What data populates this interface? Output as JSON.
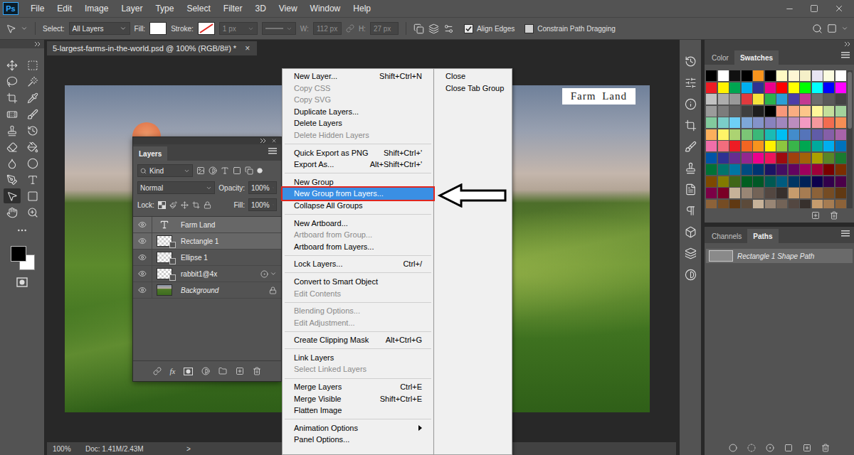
{
  "app": {
    "logo": "Ps"
  },
  "menubar": {
    "items": [
      "File",
      "Edit",
      "Image",
      "Layer",
      "Type",
      "Select",
      "Filter",
      "3D",
      "View",
      "Window",
      "Help"
    ]
  },
  "options_bar": {
    "select_label": "Select:",
    "select_value": "All Layers",
    "fill_label": "Fill:",
    "stroke_label": "Stroke:",
    "stroke_width": "1 px",
    "stroke_width_disabled": true,
    "size_fields": [
      {
        "label": "W:",
        "value": "112 px",
        "disabled": true
      },
      {
        "label": "H:",
        "value": "27 px",
        "disabled": true
      }
    ],
    "checkboxes": [
      {
        "label": "Align Edges",
        "checked": true
      },
      {
        "label": "Constrain Path Dragging",
        "checked": false
      }
    ]
  },
  "toolbar": {
    "tools": [
      {
        "selected": false
      },
      {
        "selected": false
      },
      {
        "selected": false
      },
      {
        "selected": false
      },
      {
        "selected": false
      },
      {
        "selected": false
      },
      {
        "selected": false
      },
      {
        "selected": false
      },
      {
        "selected": false
      },
      {
        "selected": false
      },
      {
        "selected": false
      },
      {
        "selected": false
      },
      {
        "selected": false
      },
      {
        "selected": false
      },
      {
        "selected": false
      },
      {
        "selected": false
      },
      {
        "selected": true
      },
      {
        "selected": false
      },
      {
        "selected": false
      },
      {
        "selected": false
      }
    ]
  },
  "document": {
    "tab": "5-largest-farms-in-the-world.psd @ 100% (RGB/8#) *",
    "close": "×",
    "canvas_text": "Farm Land",
    "zoom": "100%",
    "doc_info": "Doc: 1.41M/2.43M",
    "status_arrow": ">"
  },
  "layers_panel": {
    "title": "Layers",
    "filter": "Kind",
    "blend_mode": "Normal",
    "opacity_label": "Opacity:",
    "opacity": "100%",
    "lock_label": "Lock:",
    "fill_label": "Fill:",
    "fill": "100%",
    "fx": "fx",
    "layers": [
      {
        "name": "Farm Land",
        "kind": "text",
        "visible": true,
        "selected": true
      },
      {
        "name": "Rectangle 1",
        "kind": "shape",
        "visible": true,
        "selected": true
      },
      {
        "name": "Ellipse 1",
        "kind": "shape",
        "visible": true,
        "selected": false
      },
      {
        "name": "rabbit1@4x",
        "kind": "smart",
        "visible": true,
        "selected": false
      },
      {
        "name": "Background",
        "kind": "background",
        "visible": true,
        "selected": false
      }
    ]
  },
  "context_menu": {
    "items": [
      {
        "label": "New Layer...",
        "shortcut": "Shift+Ctrl+N",
        "disabled": false,
        "selected": false,
        "submenu": false,
        "separator_after": false
      },
      {
        "label": "Copy CSS",
        "shortcut": "",
        "disabled": true,
        "selected": false,
        "submenu": false,
        "separator_after": false
      },
      {
        "label": "Copy SVG",
        "shortcut": "",
        "disabled": true,
        "selected": false,
        "submenu": false,
        "separator_after": false
      },
      {
        "label": "Duplicate Layers...",
        "shortcut": "",
        "disabled": false,
        "selected": false,
        "submenu": false,
        "separator_after": false
      },
      {
        "label": "Delete Layers",
        "shortcut": "",
        "disabled": false,
        "selected": false,
        "submenu": false,
        "separator_after": false
      },
      {
        "label": "Delete Hidden Layers",
        "shortcut": "",
        "disabled": true,
        "selected": false,
        "submenu": false,
        "separator_after": true
      },
      {
        "label": "Quick Export as PNG",
        "shortcut": "Shift+Ctrl+'",
        "disabled": false,
        "selected": false,
        "submenu": false,
        "separator_after": false
      },
      {
        "label": "Export As...",
        "shortcut": "Alt+Shift+Ctrl+'",
        "disabled": false,
        "selected": false,
        "submenu": false,
        "separator_after": true
      },
      {
        "label": "New Group",
        "shortcut": "",
        "disabled": false,
        "selected": false,
        "submenu": false,
        "separator_after": false
      },
      {
        "label": "New Group from Layers...",
        "shortcut": "",
        "disabled": false,
        "selected": true,
        "submenu": false,
        "separator_after": false
      },
      {
        "label": "Collapse All Groups",
        "shortcut": "",
        "disabled": false,
        "selected": false,
        "submenu": false,
        "separator_after": true
      },
      {
        "label": "New Artboard...",
        "shortcut": "",
        "disabled": false,
        "selected": false,
        "submenu": false,
        "separator_after": false
      },
      {
        "label": "Artboard from Group...",
        "shortcut": "",
        "disabled": true,
        "selected": false,
        "submenu": false,
        "separator_after": false
      },
      {
        "label": "Artboard from Layers...",
        "shortcut": "",
        "disabled": false,
        "selected": false,
        "submenu": false,
        "separator_after": true
      },
      {
        "label": "Lock Layers...",
        "shortcut": "Ctrl+/",
        "disabled": false,
        "selected": false,
        "submenu": false,
        "separator_after": true
      },
      {
        "label": "Convert to Smart Object",
        "shortcut": "",
        "disabled": false,
        "selected": false,
        "submenu": false,
        "separator_after": false
      },
      {
        "label": "Edit Contents",
        "shortcut": "",
        "disabled": true,
        "selected": false,
        "submenu": false,
        "separator_after": true
      },
      {
        "label": "Blending Options...",
        "shortcut": "",
        "disabled": true,
        "selected": false,
        "submenu": false,
        "separator_after": false
      },
      {
        "label": "Edit Adjustment...",
        "shortcut": "",
        "disabled": true,
        "selected": false,
        "submenu": false,
        "separator_after": true
      },
      {
        "label": "Create Clipping Mask",
        "shortcut": "Alt+Ctrl+G",
        "disabled": false,
        "selected": false,
        "submenu": false,
        "separator_after": true
      },
      {
        "label": "Link Layers",
        "shortcut": "",
        "disabled": false,
        "selected": false,
        "submenu": false,
        "separator_after": false
      },
      {
        "label": "Select Linked Layers",
        "shortcut": "",
        "disabled": true,
        "selected": false,
        "submenu": false,
        "separator_after": true
      },
      {
        "label": "Merge Layers",
        "shortcut": "Ctrl+E",
        "disabled": false,
        "selected": false,
        "submenu": false,
        "separator_after": false
      },
      {
        "label": "Merge Visible",
        "shortcut": "Shift+Ctrl+E",
        "disabled": false,
        "selected": false,
        "submenu": false,
        "separator_after": false
      },
      {
        "label": "Flatten Image",
        "shortcut": "",
        "disabled": false,
        "selected": false,
        "submenu": false,
        "separator_after": true
      },
      {
        "label": "Animation Options",
        "shortcut": "",
        "disabled": false,
        "selected": false,
        "submenu": true,
        "separator_after": false
      },
      {
        "label": "Panel Options...",
        "shortcut": "",
        "disabled": false,
        "selected": false,
        "submenu": false,
        "separator_after": false
      }
    ],
    "side_items": [
      "Close",
      "Close Tab Group"
    ]
  },
  "color_panel": {
    "tabs": [
      {
        "label": "Color",
        "selected": false
      },
      {
        "label": "Swatches",
        "selected": true
      }
    ],
    "swatches": [
      [
        "#000000",
        "#ffffff",
        "#111111",
        "#000000",
        "#f7941d",
        "#000000",
        "#fff9c4",
        "#fef6d4",
        "#f5f0c8",
        "#e8e4f3",
        "#fbfbe0",
        "#ffffff"
      ],
      [
        "#ed1c24",
        "#fff200",
        "#00a651",
        "#00aeef",
        "#2e3192",
        "#ec008c",
        "#ff0000",
        "#ffff00",
        "#00ff00",
        "#00ffff",
        "#0000ff",
        "#ff00ff"
      ],
      [
        "#c2c2c2",
        "#adadad",
        "#999999",
        "#e03a3e",
        "#f5e33c",
        "#2bb24c",
        "#2a9fd6",
        "#4b3ea8",
        "#c23a91",
        "#6d6d6d",
        "#595959",
        "#444444"
      ],
      [
        "#9b9b9b",
        "#7c7c7c",
        "#5f5f5f",
        "#3f3f3f",
        "#1e1e1e",
        "#000000",
        "#f7977a",
        "#f9ad81",
        "#fdc68a",
        "#fff79a",
        "#c4df9b",
        "#a3d39c"
      ],
      [
        "#82ca9d",
        "#7bcdc8",
        "#6ecff6",
        "#7ea7d8",
        "#8493ca",
        "#8882be",
        "#a187be",
        "#bc8dbf",
        "#f49ac2",
        "#f6989d",
        "#f26c4f",
        "#f68e55"
      ],
      [
        "#fbaf5c",
        "#fff467",
        "#acd372",
        "#7cc576",
        "#3bb878",
        "#1abbb4",
        "#00bff3",
        "#438ccb",
        "#5574b9",
        "#605ca8",
        "#855fa8",
        "#a763a8"
      ],
      [
        "#f06ea9",
        "#f26d7d",
        "#ed1c24",
        "#f26522",
        "#f7941d",
        "#fff200",
        "#8dc63f",
        "#39b54a",
        "#00a651",
        "#00a99d",
        "#00aeef",
        "#0072bc"
      ],
      [
        "#0054a6",
        "#2e3192",
        "#662d91",
        "#92278f",
        "#ec008c",
        "#ed145b",
        "#9e0b0f",
        "#a0410d",
        "#a36209",
        "#aba000",
        "#598527",
        "#1a7b30"
      ],
      [
        "#007236",
        "#00746b",
        "#0076a3",
        "#004b80",
        "#003471",
        "#1b1464",
        "#440e62",
        "#630460",
        "#9e005d",
        "#9e0039",
        "#790000",
        "#7b2e00"
      ],
      [
        "#7d4900",
        "#827b00",
        "#406618",
        "#005e20",
        "#005826",
        "#005952",
        "#005b7f",
        "#003663",
        "#002157",
        "#0d004c",
        "#32004b",
        "#4b0049"
      ],
      [
        "#7b0046",
        "#7a0026",
        "#c7b299",
        "#998675",
        "#736357",
        "#534741",
        "#37302d",
        "#c69c6d",
        "#a67c52",
        "#8c6239",
        "#754c24",
        "#603913"
      ],
      [
        "#8c6239",
        "#754c24",
        "#603913",
        "#5c4a3a",
        "#c7b299",
        "#998675",
        "#736357",
        "#534741",
        "#37302d",
        "#c69c6d",
        "#a67c52",
        "#8c6239"
      ]
    ]
  },
  "paths_panel": {
    "tabs": [
      {
        "label": "Channels",
        "selected": false
      },
      {
        "label": "Paths",
        "selected": true
      }
    ],
    "paths": [
      {
        "name": "Rectangle 1 Shape Path",
        "selected": true
      }
    ]
  }
}
